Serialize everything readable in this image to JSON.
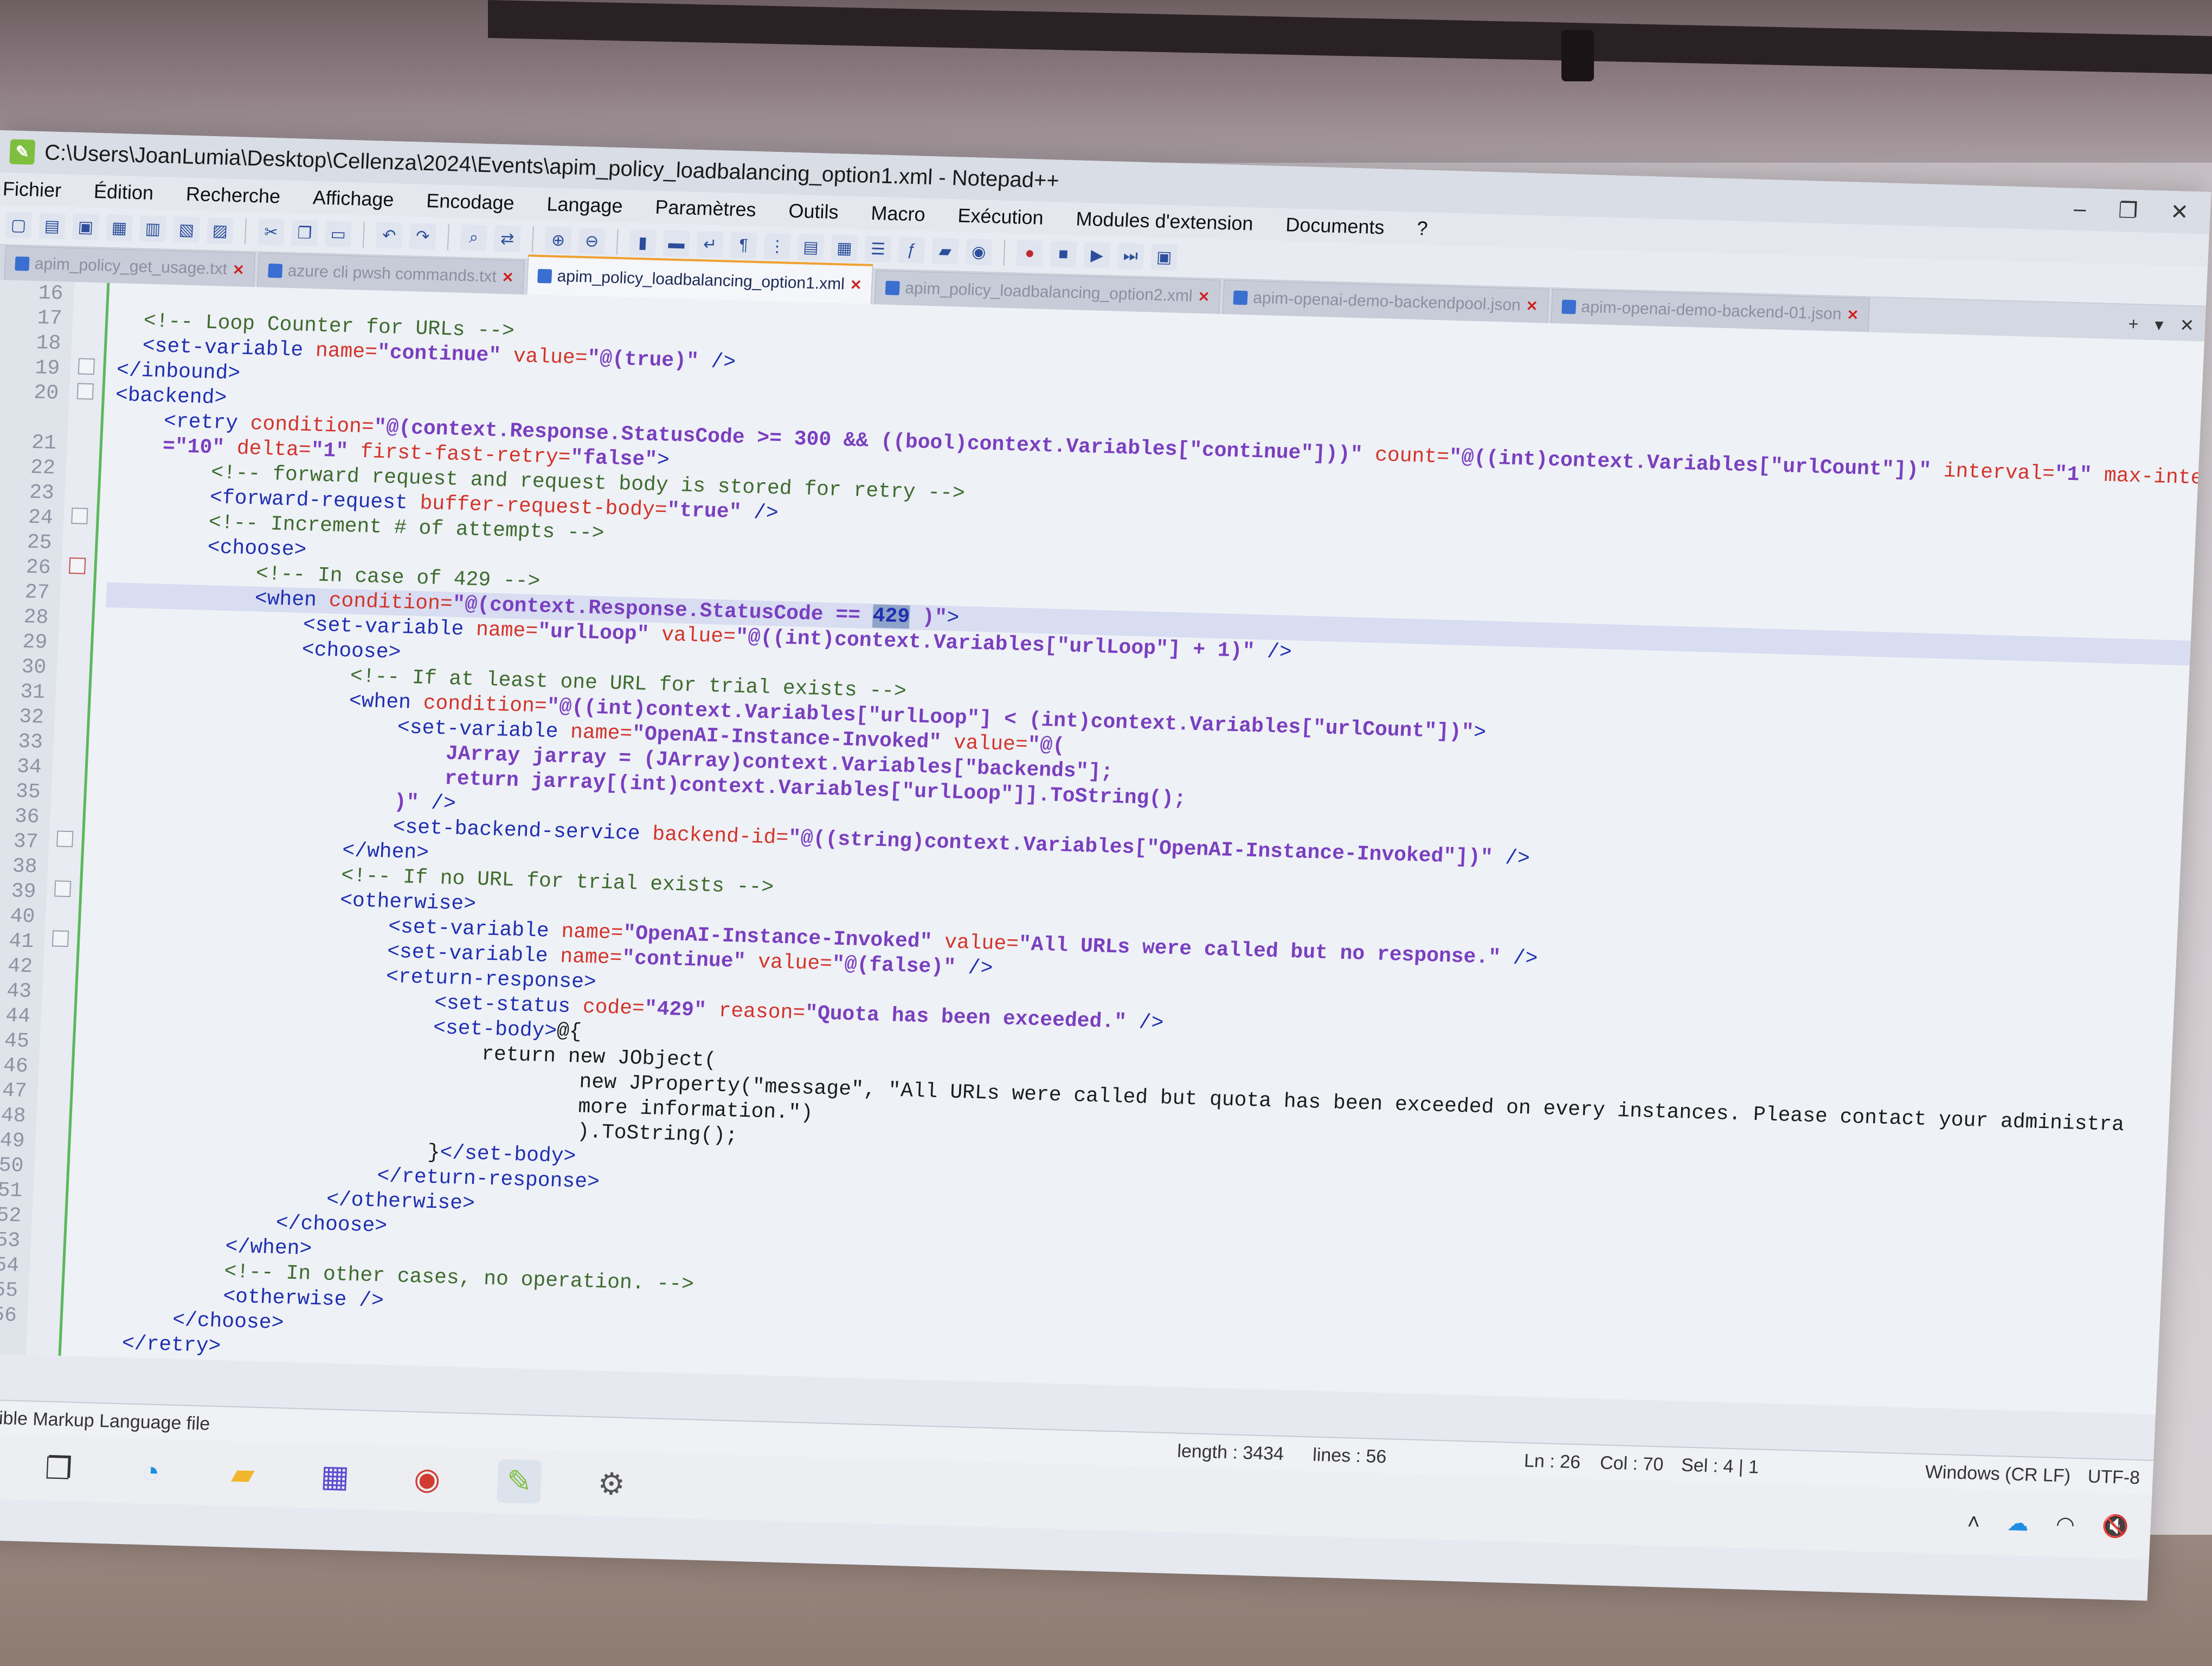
{
  "window": {
    "title": "C:\\Users\\JoanLumia\\Desktop\\Cellenza\\2024\\Events\\apim_policy_loadbalancing_option1.xml - Notepad++",
    "minimize": "–",
    "maximize": "❐",
    "close": "✕"
  },
  "menu": [
    "Fichier",
    "Édition",
    "Recherche",
    "Affichage",
    "Encodage",
    "Langage",
    "Paramètres",
    "Outils",
    "Macro",
    "Exécution",
    "Modules d'extension",
    "Documents",
    "?"
  ],
  "tabs": [
    {
      "label": "apim_policy_get_usage.txt",
      "active": false
    },
    {
      "label": "azure cli pwsh commands.txt",
      "active": false
    },
    {
      "label": "apim_policy_loadbalancing_option1.xml",
      "active": true
    },
    {
      "label": "apim_policy_loadbalancing_option2.xml",
      "active": false
    },
    {
      "label": "apim-openai-demo-backendpool.json",
      "active": false
    },
    {
      "label": "apim-openai-demo-backend-01.json",
      "active": false
    }
  ],
  "editor": {
    "line_numbers": [
      "16",
      "17",
      "18",
      "19",
      "20",
      "",
      "21",
      "22",
      "23",
      "24",
      "25",
      "26",
      "27",
      "28",
      "29",
      "30",
      "31",
      "32",
      "33",
      "34",
      "35",
      "36",
      "37",
      "38",
      "39",
      "40",
      "41",
      "42",
      "43",
      "44",
      "45",
      "46",
      "47",
      "48",
      "49",
      "50",
      "51",
      "52",
      "53",
      "54",
      "55",
      "56"
    ],
    "current_line_index": 11
  },
  "status": {
    "file_type": "eXtensible Markup Language file",
    "length": "length : 3434",
    "lines": "lines : 56",
    "ln": "Ln : 26",
    "col": "Col : 70",
    "sel": "Sel : 4 | 1",
    "eol": "Windows (CR LF)",
    "encoding": "UTF-8"
  },
  "taskbar": {
    "apps": [
      "search-icon",
      "task-view-icon",
      "edge-icon",
      "file-explorer-icon",
      "store-icon",
      "chrome-icon",
      "notepadpp-icon",
      "settings-icon"
    ]
  },
  "colors": {
    "tag": "#1f2fb0",
    "attr": "#d2342a",
    "value": "#7a3fbf",
    "comment": "#3e6b2e",
    "current_line": "#d8ddf2"
  }
}
